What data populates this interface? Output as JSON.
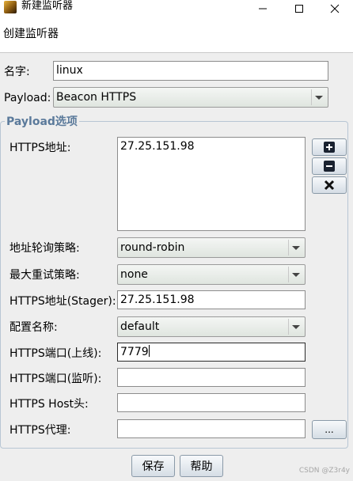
{
  "window": {
    "title": "新建监听器",
    "minimize_icon": "minimize-icon",
    "maximize_icon": "maximize-icon",
    "close_icon": "close-icon"
  },
  "header": {
    "text": "创建监听器"
  },
  "name": {
    "label": "名字:",
    "value": "linux"
  },
  "payload": {
    "label": "Payload:",
    "value": "Beacon HTTPS"
  },
  "options_group": {
    "title": "Payload选项"
  },
  "https_hosts": {
    "label": "HTTPS地址:",
    "value": "27.25.151.98",
    "add_icon": "plus-icon",
    "remove_icon": "minus-icon",
    "clear_icon": "x-icon"
  },
  "rotation": {
    "label": "地址轮询策略:",
    "value": "round-robin"
  },
  "max_retry": {
    "label": "最大重试策略:",
    "value": "none"
  },
  "stager": {
    "label": "HTTPS地址(Stager):",
    "value": "27.25.151.98"
  },
  "profile": {
    "label": "配置名称:",
    "value": "default"
  },
  "port_callback": {
    "label": "HTTPS端口(上线):",
    "value": "7779"
  },
  "port_bind": {
    "label": "HTTPS端口(监听):",
    "value": ""
  },
  "host_header": {
    "label": "HTTPS Host头:",
    "value": ""
  },
  "proxy": {
    "label": "HTTPS代理:",
    "value": "",
    "browse_label": "..."
  },
  "buttons": {
    "save": "保存",
    "help": "帮助"
  },
  "watermark": "CSDN @Z3r4y"
}
